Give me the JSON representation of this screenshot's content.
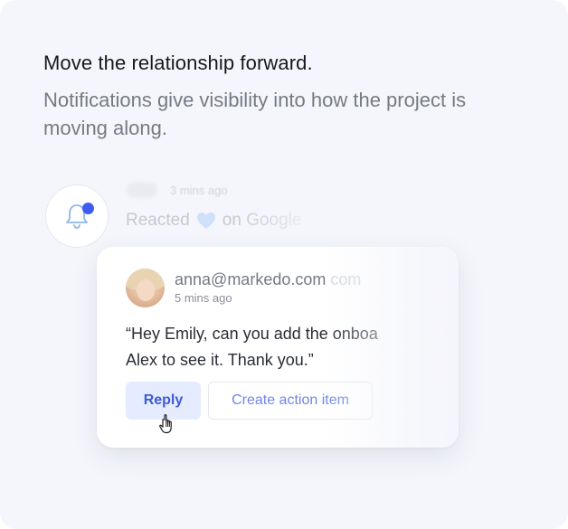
{
  "hero": {
    "headline": "Move the relationship forward.",
    "subtext": "Notifications give visibility into how the project is moving along."
  },
  "background_notification": {
    "time": "3 mins ago",
    "text_before": "Reacted",
    "text_after": "on Google"
  },
  "notification_card": {
    "sender_email": "anna@markedo.com",
    "sender_suffix": "com",
    "time": "5 mins ago",
    "message_line1": "“Hey Emily, can you add the onboa",
    "message_line2": "Alex to see it. Thank you.”",
    "reply_label": "Reply",
    "action_label": "Create action item"
  },
  "colors": {
    "accent": "#3d5ef0",
    "panel_bg": "#f5f6fb",
    "reply_bg": "#e6ecff"
  },
  "icons": {
    "bell": "bell-icon",
    "heart": "heart-icon",
    "cursor": "hand-pointer-icon"
  }
}
